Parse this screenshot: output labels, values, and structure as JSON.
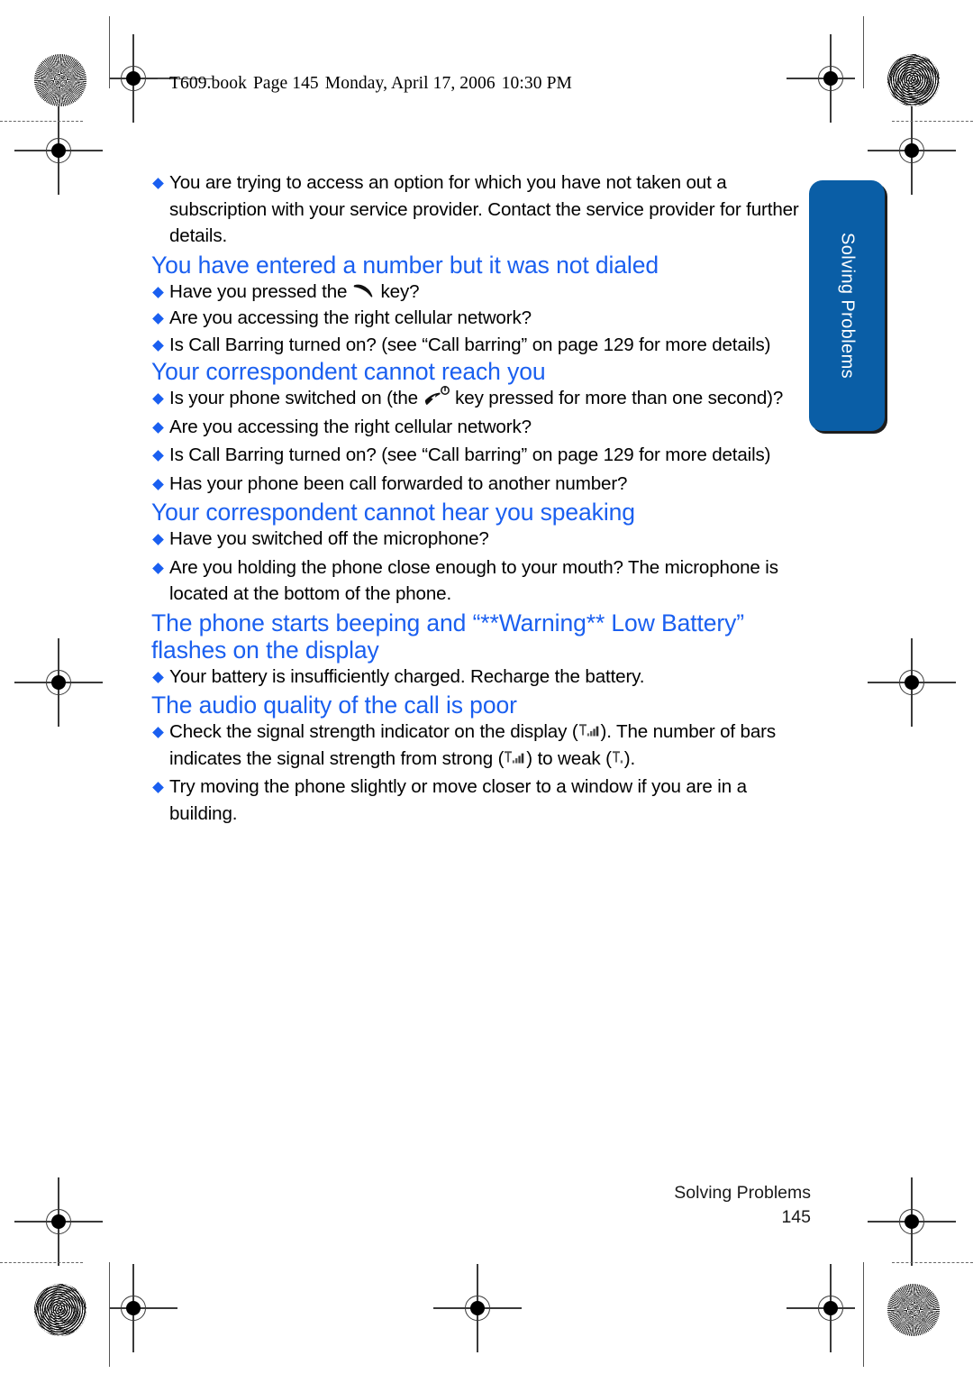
{
  "header": {
    "book": "T609.book",
    "page_label": "Page 145",
    "date": "Monday, April 17, 2006",
    "time": "10:30 PM"
  },
  "side_tab": {
    "label": "Solving Problems",
    "color": "#0a5ea6",
    "text_color": "#ffffff"
  },
  "accent_color": "#1a5ff0",
  "content": {
    "intro_bullets": [
      "You are trying to access an option for which you have not taken out a subscription with your service provider. Contact the service provider for further details."
    ],
    "sections": [
      {
        "heading": "You have entered a number but it was not dialed",
        "bullets": [
          {
            "before": "Have you pressed the ",
            "icon": "call-key-icon",
            "after": " key?"
          },
          {
            "before": "Are you accessing the right cellular network?"
          },
          {
            "before": "Is Call Barring turned on? (see “Call barring” on page 129 for more details)"
          }
        ]
      },
      {
        "heading": "Your correspondent cannot reach you",
        "bullets": [
          {
            "before": "Is your phone switched on (the ",
            "icon": "end-power-key-icon",
            "after": " key pressed for more than one second)?"
          },
          {
            "before": "Are you accessing the right cellular network?"
          },
          {
            "before": "Is Call Barring turned on? (see “Call barring” on page 129 for more details)"
          },
          {
            "before": "Has your phone been call forwarded to another number?"
          }
        ]
      },
      {
        "heading": "Your correspondent cannot hear you speaking",
        "bullets": [
          {
            "before": "Have you switched off the microphone?"
          },
          {
            "before": "Are you holding the phone close enough to your mouth? The microphone is located at the bottom of the phone."
          }
        ]
      },
      {
        "heading": "The phone starts beeping and “**Warning**  Low Battery” flashes on the display",
        "bullets": [
          {
            "before": "Your battery is insufficiently charged. Recharge the battery."
          }
        ]
      },
      {
        "heading": "The audio quality of the call is poor",
        "bullets": [
          {
            "before": "Check the signal strength indicator on the display (",
            "icon": "signal-strength-icon",
            "mid1": "). The number of bars indicates the signal strength from strong (",
            "icon2": "signal-strength-strong-icon",
            "mid2": ") to weak (",
            "icon3": "signal-strength-weak-icon",
            "after": ")."
          },
          {
            "before": "Try moving the phone slightly or move closer to a window if you are in a building."
          }
        ]
      }
    ]
  },
  "footer": {
    "chapter": "Solving Problems",
    "page_number": "145"
  }
}
